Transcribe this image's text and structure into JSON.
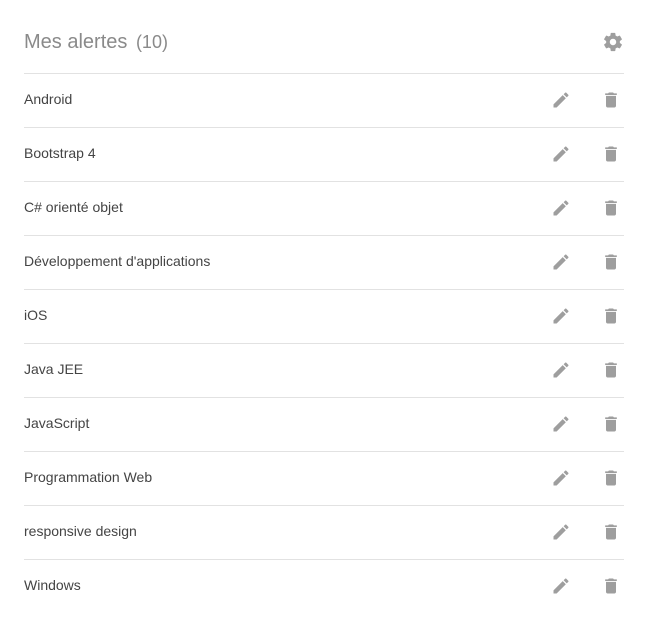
{
  "header": {
    "title": "Mes alertes",
    "count": "(10)",
    "settings_icon": "gear-icon"
  },
  "colors": {
    "title": "#8a8a8a",
    "icon": "#9e9e9e",
    "divider": "#e2e2e2",
    "text": "#444444"
  },
  "alerts": [
    {
      "label": "Android",
      "edit_icon": "pencil-icon",
      "delete_icon": "trash-icon"
    },
    {
      "label": "Bootstrap 4",
      "edit_icon": "pencil-icon",
      "delete_icon": "trash-icon"
    },
    {
      "label": "C# orienté objet",
      "edit_icon": "pencil-icon",
      "delete_icon": "trash-icon"
    },
    {
      "label": "Développement d'applications",
      "edit_icon": "pencil-icon",
      "delete_icon": "trash-icon"
    },
    {
      "label": "iOS",
      "edit_icon": "pencil-icon",
      "delete_icon": "trash-icon"
    },
    {
      "label": "Java JEE",
      "edit_icon": "pencil-icon",
      "delete_icon": "trash-icon"
    },
    {
      "label": "JavaScript",
      "edit_icon": "pencil-icon",
      "delete_icon": "trash-icon"
    },
    {
      "label": "Programmation Web",
      "edit_icon": "pencil-icon",
      "delete_icon": "trash-icon"
    },
    {
      "label": "responsive design",
      "edit_icon": "pencil-icon",
      "delete_icon": "trash-icon"
    },
    {
      "label": "Windows",
      "edit_icon": "pencil-icon",
      "delete_icon": "trash-icon"
    }
  ]
}
